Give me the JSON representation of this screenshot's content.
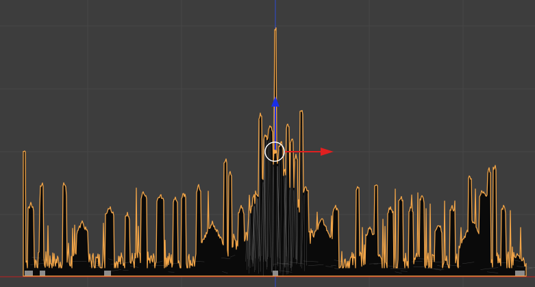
{
  "viewport": {
    "view": "front-orthographic",
    "background_color": "#3d3d3d",
    "grid_color": "#474747",
    "grid_visible": true
  },
  "scene": {
    "object_type": "city-skyline-mesh",
    "selection_outline_color": "#f2a548",
    "mesh_fill_color": "#0a0a0a",
    "wire_color": "#9a9a9a",
    "selected": true
  },
  "axes": {
    "x_axis_color": "#c32020",
    "z_axis_color": "#2d4bd2"
  },
  "gizmo": {
    "type": "translate",
    "x_handle_color": "#e02020",
    "z_handle_color": "#1a2ee6",
    "pivot_circle_color": "#ffffff",
    "pivot_dot_color": "#f2a548"
  }
}
